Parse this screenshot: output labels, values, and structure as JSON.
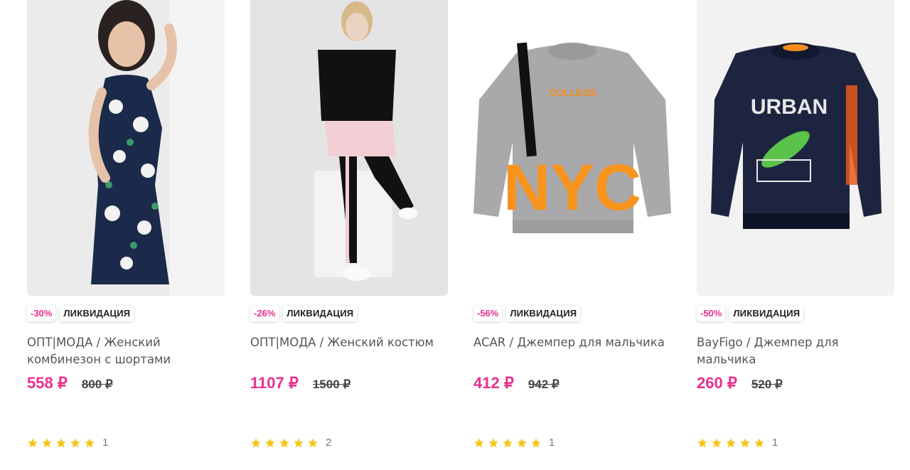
{
  "products": [
    {
      "discount": "-30%",
      "sale": "ЛИКВИДАЦИЯ",
      "title": "ОПТ|МОДА / Женский комбинезон с шортами",
      "price": "558 ₽",
      "old_price": "800 ₽",
      "rating_count": "1",
      "image": "woman-floral-romper"
    },
    {
      "discount": "-26%",
      "sale": "ЛИКВИДАЦИЯ",
      "title": "ОПТ|МОДА / Женский костюм",
      "price": "1107 ₽",
      "old_price": "1500 ₽",
      "rating_count": "2",
      "image": "woman-black-pink-suit"
    },
    {
      "discount": "-56%",
      "sale": "ЛИКВИДАЦИЯ",
      "title": "ACAR / Джемпер для мальчика",
      "price": "412 ₽",
      "old_price": "942 ₽",
      "rating_count": "1",
      "image": "grey-nyc-sweatshirt",
      "print_text": "NYC"
    },
    {
      "discount": "-50%",
      "sale": "ЛИКВИДАЦИЯ",
      "title": "BayFigo / Джемпер для мальчика",
      "price": "260 ₽",
      "old_price": "520 ₽",
      "rating_count": "1",
      "image": "navy-urban-skate-sweatshirt",
      "print_text": "URBAN"
    }
  ],
  "colors": {
    "accent": "#e8308e",
    "star": "#f5c518"
  }
}
